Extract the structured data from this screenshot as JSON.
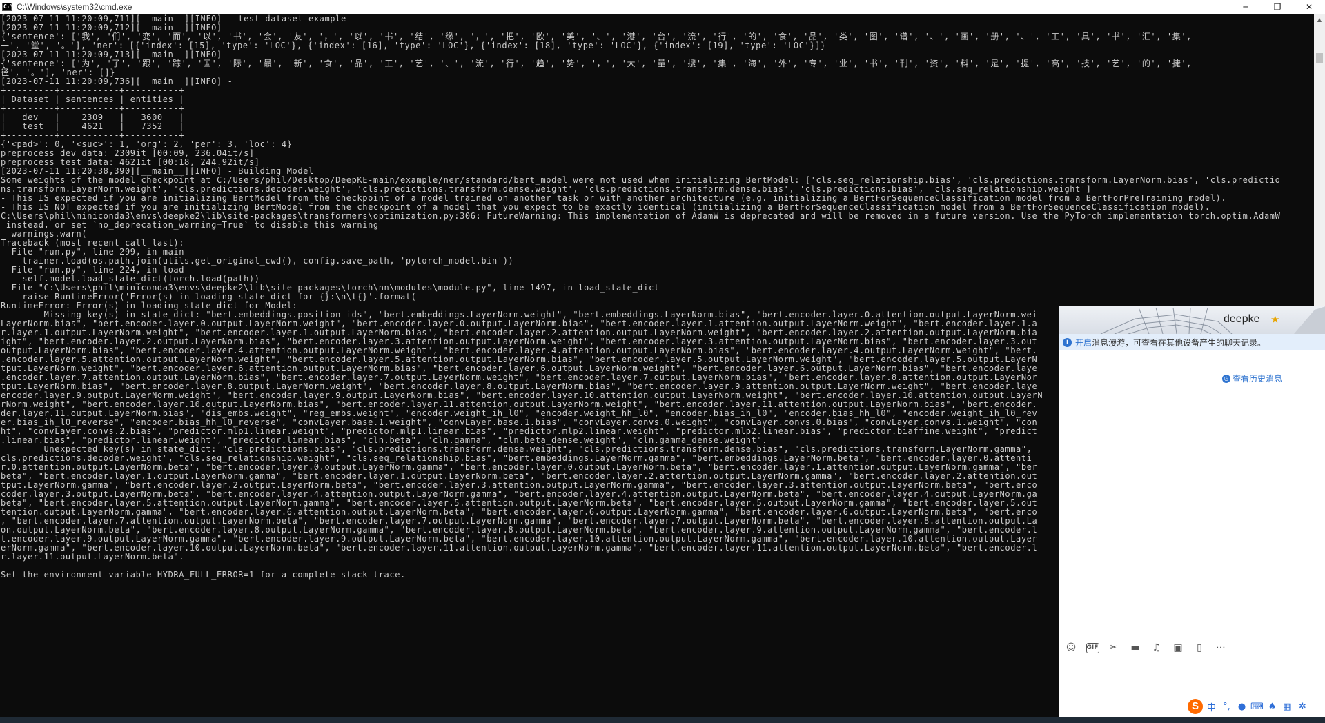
{
  "window": {
    "title": "C:\\Windows\\system32\\cmd.exe",
    "icon": "cmd-icon",
    "controls": [
      "minimize-icon",
      "maximize-icon",
      "close-icon"
    ]
  },
  "console": {
    "lines": [
      "[2023-07-11 11:20:09,711][__main__][INFO] - test dataset example",
      "[2023-07-11 11:20:09,712][__main__][INFO] -",
      "{'sentence': ['我', '们', '变', '而', '以', '书', '会', '友', '，', '以', '书', '结', '缘', '，', '把', '欧', '美', '、', '港', '台', '流', '行', '的', '食', '品', '类', '图', '谱', '、', '画', '册', '、', '工', '具', '书', '汇', '集',",
      "一', '堂', '。'], 'ner': [{'index': [15], 'type': 'LOC'}, {'index': [16], 'type': 'LOC'}, {'index': [18], 'type': 'LOC'}, {'index': [19], 'type': 'LOC'}]}",
      "[2023-07-11 11:20:09,713][__main__][INFO] -",
      "{'sentence': ['为', '了', '跟', '踪', '国', '际', '最', '新', '食', '品', '工', '艺', '、', '流', '行', '趋', '势', '，', '大', '量', '搜', '集', '海', '外', '专', '业', '书', '刊', '资', '料', '是', '提', '高', '技', '艺', '的', '捷',",
      "径', '。'], 'ner': []}",
      "[2023-07-11 11:20:09,736][__main__][INFO] -",
      "+---------+-----------+----------+",
      "| Dataset | sentences | entities |",
      "+---------+-----------+----------+",
      "|   dev   |    2309   |   3600   |",
      "|   test  |    4621   |   7352   |",
      "+---------+-----------+----------+",
      "{'<pad>': 0, '<suc>': 1, 'org': 2, 'per': 3, 'loc': 4}",
      "preprocess dev data: 2309it [00:09, 236.04it/s]",
      "preprocess test data: 4621it [00:18, 244.92it/s]",
      "[2023-07-11 11:20:38,390][__main__][INFO] - Building Model",
      "Some weights of the model checkpoint at C:/Users/phil/Desktop/DeepKE-main/example/ner/standard/bert_model were not used when initializing BertModel: ['cls.seq_relationship.bias', 'cls.predictions.transform.LayerNorm.bias', 'cls.predictio",
      "ns.transform.LayerNorm.weight', 'cls.predictions.decoder.weight', 'cls.predictions.transform.dense.weight', 'cls.predictions.transform.dense.bias', 'cls.predictions.bias', 'cls.seq_relationship.weight']",
      "- This IS expected if you are initializing BertModel from the checkpoint of a model trained on another task or with another architecture (e.g. initializing a BertForSequenceClassification model from a BertForPreTraining model).",
      "- This IS NOT expected if you are initializing BertModel from the checkpoint of a model that you expect to be exactly identical (initializing a BertForSequenceClassification model from a BertForSequenceClassification model).",
      "C:\\Users\\phil\\miniconda3\\envs\\deepke2\\lib\\site-packages\\transformers\\optimization.py:306: FutureWarning: This implementation of AdamW is deprecated and will be removed in a future version. Use the PyTorch implementation torch.optim.AdamW",
      " instead, or set `no_deprecation_warning=True` to disable this warning",
      "  warnings.warn(",
      "Traceback (most recent call last):",
      "  File \"run.py\", line 299, in main",
      "    trainer.load(os.path.join(utils.get_original_cwd(), config.save_path, 'pytorch_model.bin'))",
      "  File \"run.py\", line 224, in load",
      "    self.model.load_state_dict(torch.load(path))",
      "  File \"C:\\Users\\phil\\miniconda3\\envs\\deepke2\\lib\\site-packages\\torch\\nn\\modules\\module.py\", line 1497, in load_state_dict",
      "    raise RuntimeError('Error(s) in loading state_dict for {}:\\n\\t{}'.format(",
      "RuntimeError: Error(s) in loading state_dict for Model:",
      "\tMissing key(s) in state_dict: \"bert.embeddings.position_ids\", \"bert.embeddings.LayerNorm.weight\", \"bert.embeddings.LayerNorm.bias\", \"bert.encoder.layer.0.attention.output.LayerNorm.wei",
      "LayerNorm.bias\", \"bert.encoder.layer.0.output.LayerNorm.weight\", \"bert.encoder.layer.0.output.LayerNorm.bias\", \"bert.encoder.layer.1.attention.output.LayerNorm.weight\", \"bert.encoder.layer.1.a",
      "r.layer.1.output.LayerNorm.weight\", \"bert.encoder.layer.1.output.LayerNorm.bias\", \"bert.encoder.layer.2.attention.output.LayerNorm.weight\", \"bert.encoder.layer.2.attention.output.LayerNorm.bia",
      "ight\", \"bert.encoder.layer.2.output.LayerNorm.bias\", \"bert.encoder.layer.3.attention.output.LayerNorm.weight\", \"bert.encoder.layer.3.attention.output.LayerNorm.bias\", \"bert.encoder.layer.3.out",
      "output.LayerNorm.bias\", \"bert.encoder.layer.4.attention.output.LayerNorm.weight\", \"bert.encoder.layer.4.attention.output.LayerNorm.bias\", \"bert.encoder.layer.4.output.LayerNorm.weight\", \"bert.",
      ".encoder.layer.5.attention.output.LayerNorm.weight\", \"bert.encoder.layer.5.attention.output.LayerNorm.bias\", \"bert.encoder.layer.5.output.LayerNorm.weight\", \"bert.encoder.layer.5.output.LayerN",
      "tput.LayerNorm.weight\", \"bert.encoder.layer.6.attention.output.LayerNorm.bias\", \"bert.encoder.layer.6.output.LayerNorm.weight\", \"bert.encoder.layer.6.output.LayerNorm.bias\", \"bert.encoder.laye",
      ".encoder.layer.7.attention.output.LayerNorm.bias\", \"bert.encoder.layer.7.output.LayerNorm.weight\", \"bert.encoder.layer.7.output.LayerNorm.bias\", \"bert.encoder.layer.8.attention.output.LayerNor",
      "tput.LayerNorm.bias\", \"bert.encoder.layer.8.output.LayerNorm.weight\", \"bert.encoder.layer.8.output.LayerNorm.bias\", \"bert.encoder.layer.9.attention.output.LayerNorm.weight\", \"bert.encoder.laye",
      "encoder.layer.9.output.LayerNorm.weight\", \"bert.encoder.layer.9.output.LayerNorm.bias\", \"bert.encoder.layer.10.attention.output.LayerNorm.weight\", \"bert.encoder.layer.10.attention.output.LayerN",
      "rNorm.weight\", \"bert.encoder.layer.10.output.LayerNorm.bias\", \"bert.encoder.layer.11.attention.output.LayerNorm.weight\", \"bert.encoder.layer.11.attention.output.LayerNorm.bias\", \"bert.encoder.",
      "der.layer.11.output.LayerNorm.bias\", \"dis_embs.weight\", \"reg_embs.weight\", \"encoder.weight_ih_l0\", \"encoder.weight_hh_l0\", \"encoder.bias_ih_l0\", \"encoder.bias_hh_l0\", \"encoder.weight_ih_l0_rev",
      "er.bias_ih_l0_reverse\", \"encoder.bias_hh_l0_reverse\", \"convLayer.base.1.weight\", \"convLayer.base.1.bias\", \"convLayer.convs.0.weight\", \"convLayer.convs.0.bias\", \"convLayer.convs.1.weight\", \"con",
      "ht\", \"convLayer.convs.2.bias\", \"predictor.mlp1.linear.weight\", \"predictor.mlp1.linear.bias\", \"predictor.mlp2.linear.weight\", \"predictor.mlp2.linear.bias\", \"predictor.biaffine.weight\", \"predict",
      ".linear.bias\", \"predictor.linear.weight\", \"predictor.linear.bias\", \"cln.beta\", \"cln.gamma\", \"cln.beta_dense.weight\", \"cln.gamma_dense.weight\".",
      "\tUnexpected key(s) in state_dict: \"cls.predictions.bias\", \"cls.predictions.transform.dense.weight\", \"cls.predictions.transform.dense.bias\", \"cls.predictions.transform.LayerNorm.gamma\",",
      "cls.predictions.decoder.weight\", \"cls.seq_relationship.weight\", \"cls.seq_relationship.bias\", \"bert.embeddings.LayerNorm.gamma\", \"bert.embeddings.LayerNorm.beta\", \"bert.encoder.layer.0.attenti",
      "r.0.attention.output.LayerNorm.beta\", \"bert.encoder.layer.0.output.LayerNorm.gamma\", \"bert.encoder.layer.0.output.LayerNorm.beta\", \"bert.encoder.layer.1.attention.output.LayerNorm.gamma\", \"ber",
      "beta\", \"bert.encoder.layer.1.output.LayerNorm.gamma\", \"bert.encoder.layer.1.output.LayerNorm.beta\", \"bert.encoder.layer.2.attention.output.LayerNorm.gamma\", \"bert.encoder.layer.2.attention.out",
      "tput.LayerNorm.gamma\", \"bert.encoder.layer.2.output.LayerNorm.beta\", \"bert.encoder.layer.3.attention.output.LayerNorm.gamma\", \"bert.encoder.layer.3.attention.output.LayerNorm.beta\", \"bert.enco",
      "coder.layer.3.output.LayerNorm.beta\", \"bert.encoder.layer.4.attention.output.LayerNorm.gamma\", \"bert.encoder.layer.4.attention.output.LayerNorm.beta\", \"bert.encoder.layer.4.output.LayerNorm.ga",
      "beta\", \"bert.encoder.layer.5.attention.output.LayerNorm.gamma\", \"bert.encoder.layer.5.attention.output.LayerNorm.beta\", \"bert.encoder.layer.5.output.LayerNorm.gamma\", \"bert.encoder.layer.5.out",
      "tention.output.LayerNorm.gamma\", \"bert.encoder.layer.6.attention.output.LayerNorm.beta\", \"bert.encoder.layer.6.output.LayerNorm.gamma\", \"bert.encoder.layer.6.output.LayerNorm.beta\", \"bert.enco",
      ", \"bert.encoder.layer.7.attention.output.LayerNorm.beta\", \"bert.encoder.layer.7.output.LayerNorm.gamma\", \"bert.encoder.layer.7.output.LayerNorm.beta\", \"bert.encoder.layer.8.attention.output.La",
      "on.output.LayerNorm.beta\", \"bert.encoder.layer.8.output.LayerNorm.gamma\", \"bert.encoder.layer.8.output.LayerNorm.beta\", \"bert.encoder.layer.9.attention.output.LayerNorm.gamma\", \"bert.encoder.l",
      "t.encoder.layer.9.output.LayerNorm.gamma\", \"bert.encoder.layer.9.output.LayerNorm.beta\", \"bert.encoder.layer.10.attention.output.LayerNorm.gamma\", \"bert.encoder.layer.10.attention.output.Layer",
      "erNorm.gamma\", \"bert.encoder.layer.10.output.LayerNorm.beta\", \"bert.encoder.layer.11.attention.output.LayerNorm.gamma\", \"bert.encoder.layer.11.attention.output.LayerNorm.beta\", \"bert.encoder.l",
      "r.layer.11.output.LayerNorm.beta\".",
      "",
      "Set the environment variable HYDRA_FULL_ERROR=1 for a complete stack trace."
    ]
  },
  "chat": {
    "contact_name": "deepke",
    "notice_link": "开启",
    "notice_text": "消息漫游，可查看在其他设备产生的聊天记录。",
    "history_link": "查看历史消息",
    "toolbar_icons": [
      "emoji-icon",
      "gif-icon",
      "scissors-icon",
      "folder-icon",
      "music-icon",
      "image-icon",
      "phone-icon",
      "more-icon"
    ],
    "gif_label": "GIF"
  },
  "ime": {
    "mode_label": "中",
    "icons": [
      "sogou-icon",
      "punctuation-icon",
      "microphone-icon",
      "keyboard-icon",
      "skin-icon",
      "grid-icon",
      "settings-icon"
    ]
  },
  "colors": {
    "console_bg": "#0c0c0c",
    "console_fg": "#cccccc",
    "accent_blue": "#2f74d0",
    "ime_orange": "#ff6a00"
  }
}
